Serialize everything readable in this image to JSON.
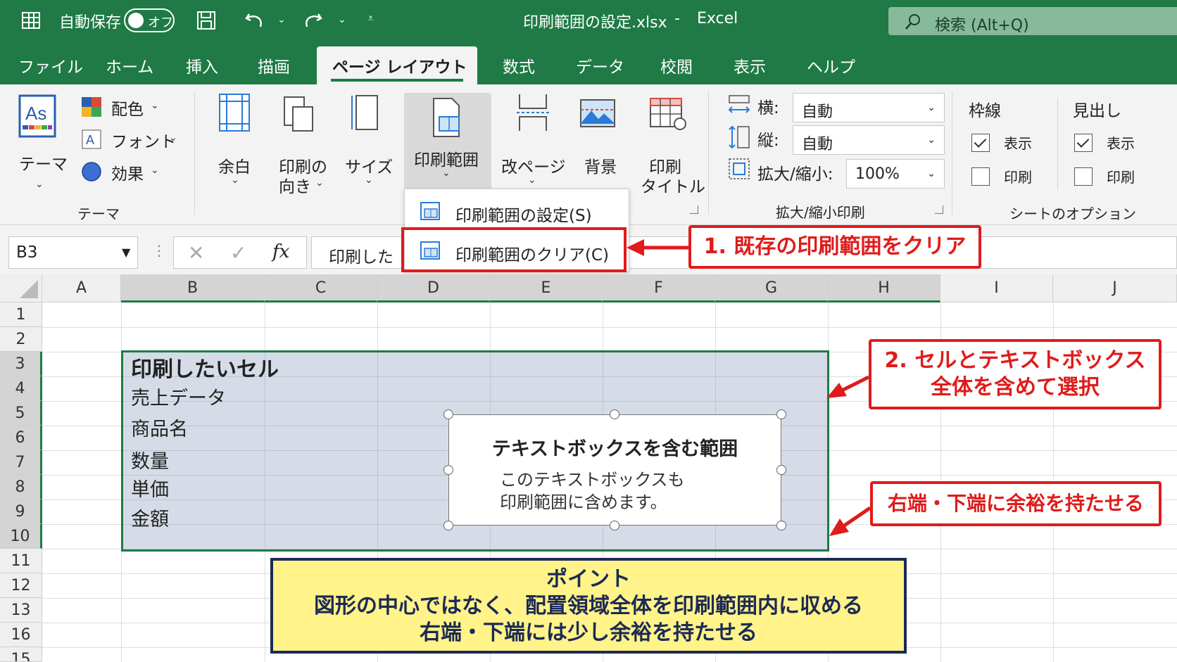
{
  "titlebar": {
    "autosave_label": "自動保存",
    "toggle_label": "オフ",
    "filename": "印刷範囲の設定.xlsx",
    "dash": "-",
    "app_name": "Excel",
    "search_placeholder": "検索 (Alt+Q)"
  },
  "menu": {
    "tabs": [
      "ファイル",
      "ホーム",
      "挿入",
      "描画",
      "ページ レイアウト",
      "数式",
      "データ",
      "校閲",
      "表示",
      "ヘルプ"
    ],
    "active_tab": "ページ レイアウト"
  },
  "ribbon": {
    "theme_label": "テーマ",
    "colors_label": "配色",
    "fonts_label": "フォント",
    "effects_label": "効果",
    "theme_group": "テーマ",
    "margins_label": "余白",
    "orientation_label": [
      "印刷の",
      "向き"
    ],
    "size_label": "サイズ",
    "print_area_label": "印刷範囲",
    "breaks_label": "改ページ",
    "background_label": "背景",
    "print_titles_label": [
      "印刷",
      "タイトル"
    ],
    "width_label": "横:",
    "width_value": "自動",
    "height_label": "縦:",
    "height_value": "自動",
    "scale_label": "拡大/縮小:",
    "scale_value": "100%",
    "scale_group": "拡大/縮小印刷",
    "gridlines_label": "枠線",
    "headings_label": "見出し",
    "view_label": "表示",
    "print_label": "印刷",
    "gridlines_view": true,
    "gridlines_print": false,
    "headings_view": true,
    "headings_print": false,
    "sheet_options_group": "シートのオプション"
  },
  "dropdown": {
    "set_print_area": "印刷範囲の設定(S)",
    "clear_print_area": "印刷範囲のクリア(C)"
  },
  "formula_bar": {
    "name_box": "B3",
    "fx_label": "fx",
    "formula": "印刷した"
  },
  "grid": {
    "columns": [
      "A",
      "B",
      "C",
      "D",
      "E",
      "F",
      "G",
      "H",
      "I",
      "J"
    ],
    "rows": [
      "1",
      "2",
      "3",
      "4",
      "5",
      "6",
      "7",
      "8",
      "9",
      "10",
      "11",
      "12",
      "13",
      "16",
      "15"
    ],
    "cells": {
      "b3": "印刷したいセル",
      "b4": "売上データ",
      "b5": "商品名",
      "b7": "数量",
      "b8": "単価",
      "b9": "金額"
    }
  },
  "textbox": {
    "title": "テキストボックスを含む範囲",
    "line1": "このテキストボックスも",
    "line2": "印刷範囲に含めます。"
  },
  "callouts": {
    "step1": "1. 既存の印刷範囲をクリア",
    "step2_line1": "2. セルとテキストボックス",
    "step2_line2": "全体を含めて選択",
    "margin_note": "右端・下端に余裕を持たせる"
  },
  "point_box": {
    "title": "ポイント",
    "line1": "図形の中心ではなく、配置領域全体を印刷範囲内に収める",
    "line2": "右端・下端には少し余裕を持たせる"
  },
  "colors": {
    "excel_green": "#1f7a45",
    "callout_red": "#e01b1b",
    "point_yellow": "#fff38a",
    "point_navy": "#1c2a55"
  }
}
